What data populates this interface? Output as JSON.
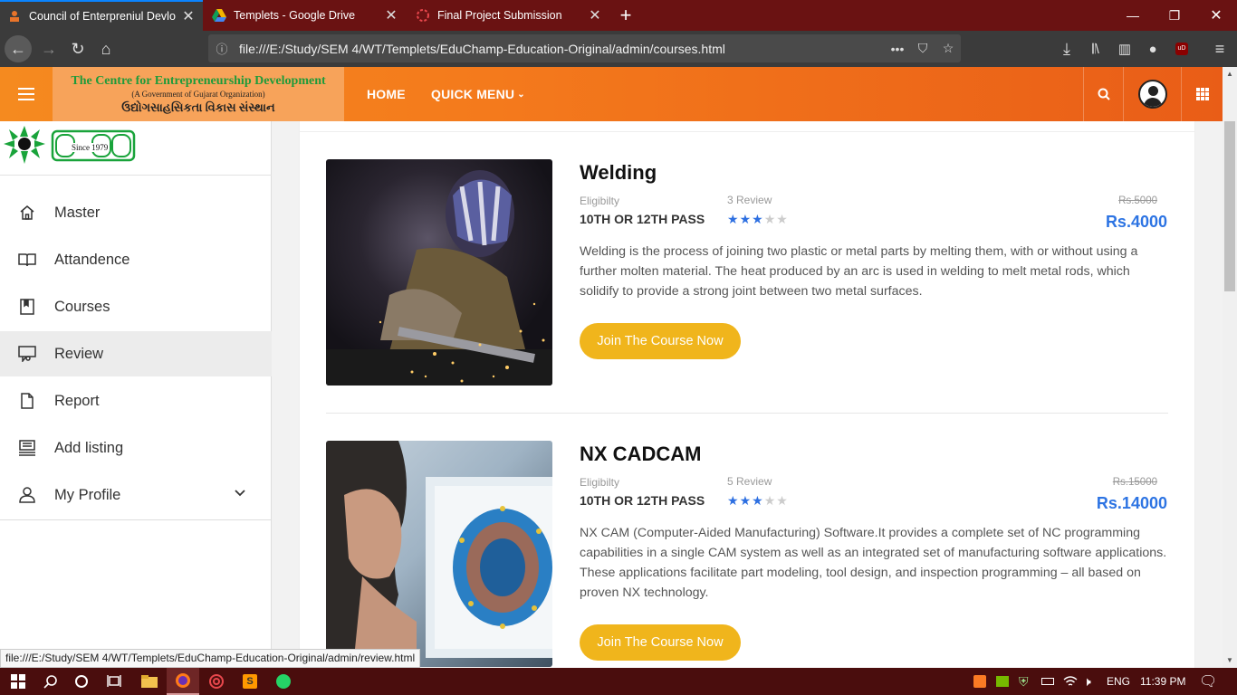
{
  "browser": {
    "tabs": [
      {
        "title": "Council of Enterpreniul Devlop",
        "icon": "council-favicon"
      },
      {
        "title": "Templets - Google Drive",
        "icon": "google-drive-favicon"
      },
      {
        "title": "Final Project Submission",
        "icon": "loading-spinner-favicon"
      }
    ],
    "new_tab": "+",
    "url": "file:///E:/Study/SEM 4/WT/Templets/EduChamp-Education-Original/admin/courses.html",
    "status_url": "file:///E:/Study/SEM 4/WT/Templets/EduChamp-Education-Original/admin/review.html"
  },
  "header": {
    "logo_line1": "The Centre for Entrepreneurship Development",
    "logo_line2": "(A Government of Gujarat Organization)",
    "logo_line3": "ઉદ્યોગસાહસિકતા વિકાસ સંસ્થાન",
    "nav": [
      "HOME",
      "QUICK MENU"
    ],
    "accent": "#f47a1c"
  },
  "sidebar": {
    "logo_text": "Since 1979",
    "items": [
      {
        "label": "Master",
        "icon": "home-icon"
      },
      {
        "label": "Attandence",
        "icon": "book-open-icon"
      },
      {
        "label": "Courses",
        "icon": "bookmark-book-icon"
      },
      {
        "label": "Review",
        "icon": "review-chat-icon",
        "selected": true
      },
      {
        "label": "Report",
        "icon": "file-icon"
      },
      {
        "label": "Add listing",
        "icon": "listing-icon"
      },
      {
        "label": "My Profile",
        "icon": "user-icon"
      }
    ]
  },
  "courses": [
    {
      "title": "Welding",
      "eligibility_label": "Eligibilty",
      "eligibility": "10TH OR 12TH PASS",
      "reviews": "3 Review",
      "rating": 3,
      "old_price": "Rs.5000",
      "price": "Rs.4000",
      "description": "Welding is the process of joining two plastic or metal parts by melting them, with or without using a further molten material. The heat produced by an arc is used in welding to melt metal rods, which solidify to provide a strong joint between two metal surfaces.",
      "button": "Join The Course Now"
    },
    {
      "title": "NX CADCAM",
      "eligibility_label": "Eligibilty",
      "eligibility": "10TH OR 12TH PASS",
      "reviews": "5 Review",
      "rating": 3,
      "old_price": "Rs.15000",
      "price": "Rs.14000",
      "description": "NX CAM (Computer-Aided Manufacturing) Software.It provides a complete set of NC programming capabilities in a single CAM system as well as an integrated set of manufacturing software applications. These applications facilitate part modeling, tool design, and inspection programming – all based on proven NX technology.",
      "button": "Join The Course Now"
    }
  ],
  "taskbar": {
    "language": "ENG",
    "time": "11:39 PM"
  }
}
